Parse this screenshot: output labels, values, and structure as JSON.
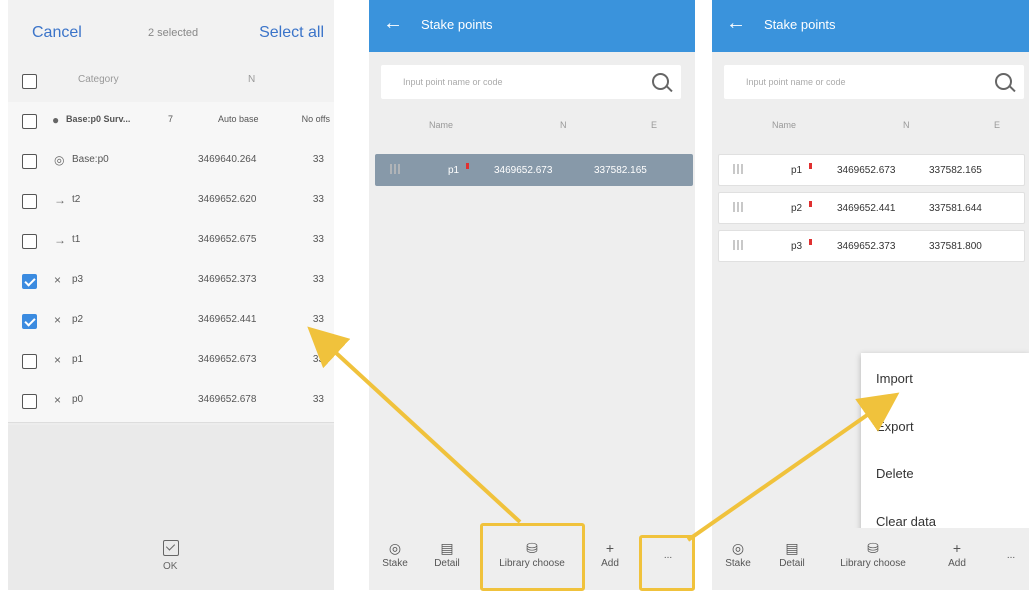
{
  "left": {
    "cancel": "Cancel",
    "count": "2 selected",
    "select_all": "Select all",
    "header": {
      "category": "Category",
      "n": "N"
    },
    "group": {
      "name": "Base:p0 Surv...",
      "count": "7",
      "type": "Auto base",
      "offset": "No offs"
    },
    "rows": [
      {
        "icon": "◎",
        "name": "Base:p0",
        "n": "3469640.264",
        "e": "33",
        "checked": false
      },
      {
        "icon": "→",
        "name": "t2",
        "n": "3469652.620",
        "e": "33",
        "checked": false
      },
      {
        "icon": "→",
        "name": "t1",
        "n": "3469652.675",
        "e": "33",
        "checked": false
      },
      {
        "icon": "×",
        "name": "p3",
        "n": "3469652.373",
        "e": "33",
        "checked": true
      },
      {
        "icon": "×",
        "name": "p2",
        "n": "3469652.441",
        "e": "33",
        "checked": true
      },
      {
        "icon": "×",
        "name": "p1",
        "n": "3469652.673",
        "e": "33",
        "checked": false
      },
      {
        "icon": "×",
        "name": "p0",
        "n": "3469652.678",
        "e": "33",
        "checked": false
      }
    ],
    "ok": "OK"
  },
  "mid": {
    "title": "Stake points",
    "search_placeholder": "Input point name or code",
    "cols": {
      "name": "Name",
      "n": "N",
      "e": "E"
    },
    "rows": [
      {
        "name": "p1",
        "n": "3469652.673",
        "e": "337582.165"
      }
    ],
    "toolbar": {
      "stake": "Stake",
      "detail": "Detail",
      "library": "Library choose",
      "add": "Add",
      "more": "..."
    }
  },
  "right": {
    "title": "Stake points",
    "search_placeholder": "Input point name or code",
    "cols": {
      "name": "Name",
      "n": "N",
      "e": "E"
    },
    "rows": [
      {
        "name": "p1",
        "n": "3469652.673",
        "e": "337582.165"
      },
      {
        "name": "p2",
        "n": "3469652.441",
        "e": "337581.644"
      },
      {
        "name": "p3",
        "n": "3469652.373",
        "e": "337581.800"
      }
    ],
    "menu": {
      "import": "Import",
      "export": "Export",
      "delete": "Delete",
      "clear": "Clear data"
    },
    "toolbar": {
      "stake": "Stake",
      "detail": "Detail",
      "library": "Library choose",
      "add": "Add",
      "more": "..."
    }
  },
  "colors": {
    "accent": "#3a93dc",
    "highlight": "#f0c23c",
    "checked": "#3b8be0"
  }
}
